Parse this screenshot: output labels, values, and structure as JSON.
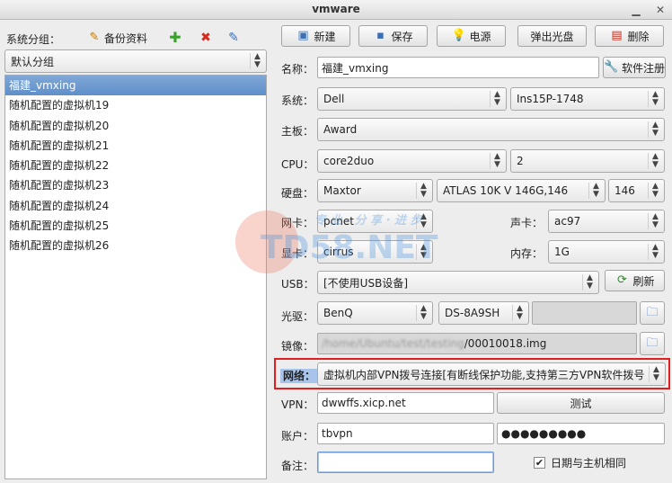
{
  "window": {
    "title": "vmware"
  },
  "left": {
    "group_label": "系统分组：",
    "backup_label": "备份资料",
    "group_select": "默认分组",
    "vm_list": [
      "福建_vmxing",
      "随机配置的虚拟机19",
      "随机配置的虚拟机20",
      "随机配置的虚拟机21",
      "随机配置的虚拟机22",
      "随机配置的虚拟机23",
      "随机配置的虚拟机24",
      "随机配置的虚拟机25",
      "随机配置的虚拟机26"
    ]
  },
  "toolbar": {
    "new": "新建",
    "save": "保存",
    "power": "电源",
    "eject": "弹出光盘",
    "delete": "删除"
  },
  "form": {
    "name_label": "名称：",
    "name_value": "福建_vmxing",
    "register_label": "软件注册",
    "system_label": "系统：",
    "system_vendor": "Dell",
    "system_model": "Ins15P-1748",
    "board_label": "主板：",
    "board_value": "Award",
    "cpu_label": "CPU：",
    "cpu_model": "core2duo",
    "cpu_count": "2",
    "disk_label": "硬盘：",
    "disk_vendor": "Maxtor",
    "disk_model": "ATLAS 10K V 146G,146",
    "disk_size": "146",
    "nic_label": "网卡：",
    "nic_value": "pcnet",
    "sound_label": "声卡：",
    "sound_value": "ac97",
    "video_label": "显卡：",
    "video_value": "cirrus",
    "mem_label": "内存：",
    "mem_value": "1G",
    "usb_label": "USB：",
    "usb_value": "[不使用USB设备]",
    "refresh_label": "刷新",
    "optical_label": "光驱：",
    "optical_vendor": "BenQ",
    "optical_model": "DS-8A9SH",
    "image_label": "镜像：",
    "image_path_hidden": "/home/Ubuntu/test/testing",
    "image_path_visible": "/00010018.img",
    "network_label": "网络：",
    "network_value": "虚拟机内部VPN拨号连接[有断线保护功能,支持第三方VPN软件拨号",
    "vpn_label": "VPN：",
    "vpn_value": "dwwffs.xicp.net",
    "test_label": "测试",
    "account_label": "账户：",
    "account_value": "tbvpn",
    "password_value": "●●●●●●●●●",
    "note_label": "备注：",
    "note_value": "",
    "sync_date_label": "日期与主机相同"
  },
  "watermark": {
    "text": "TD58.NET",
    "tagline": "专 业 · 分 享 · 进 步"
  },
  "colors": {
    "selection": "#6b97cf",
    "highlight_border": "#e02020",
    "network_label_bg": "#a8c4ea"
  }
}
